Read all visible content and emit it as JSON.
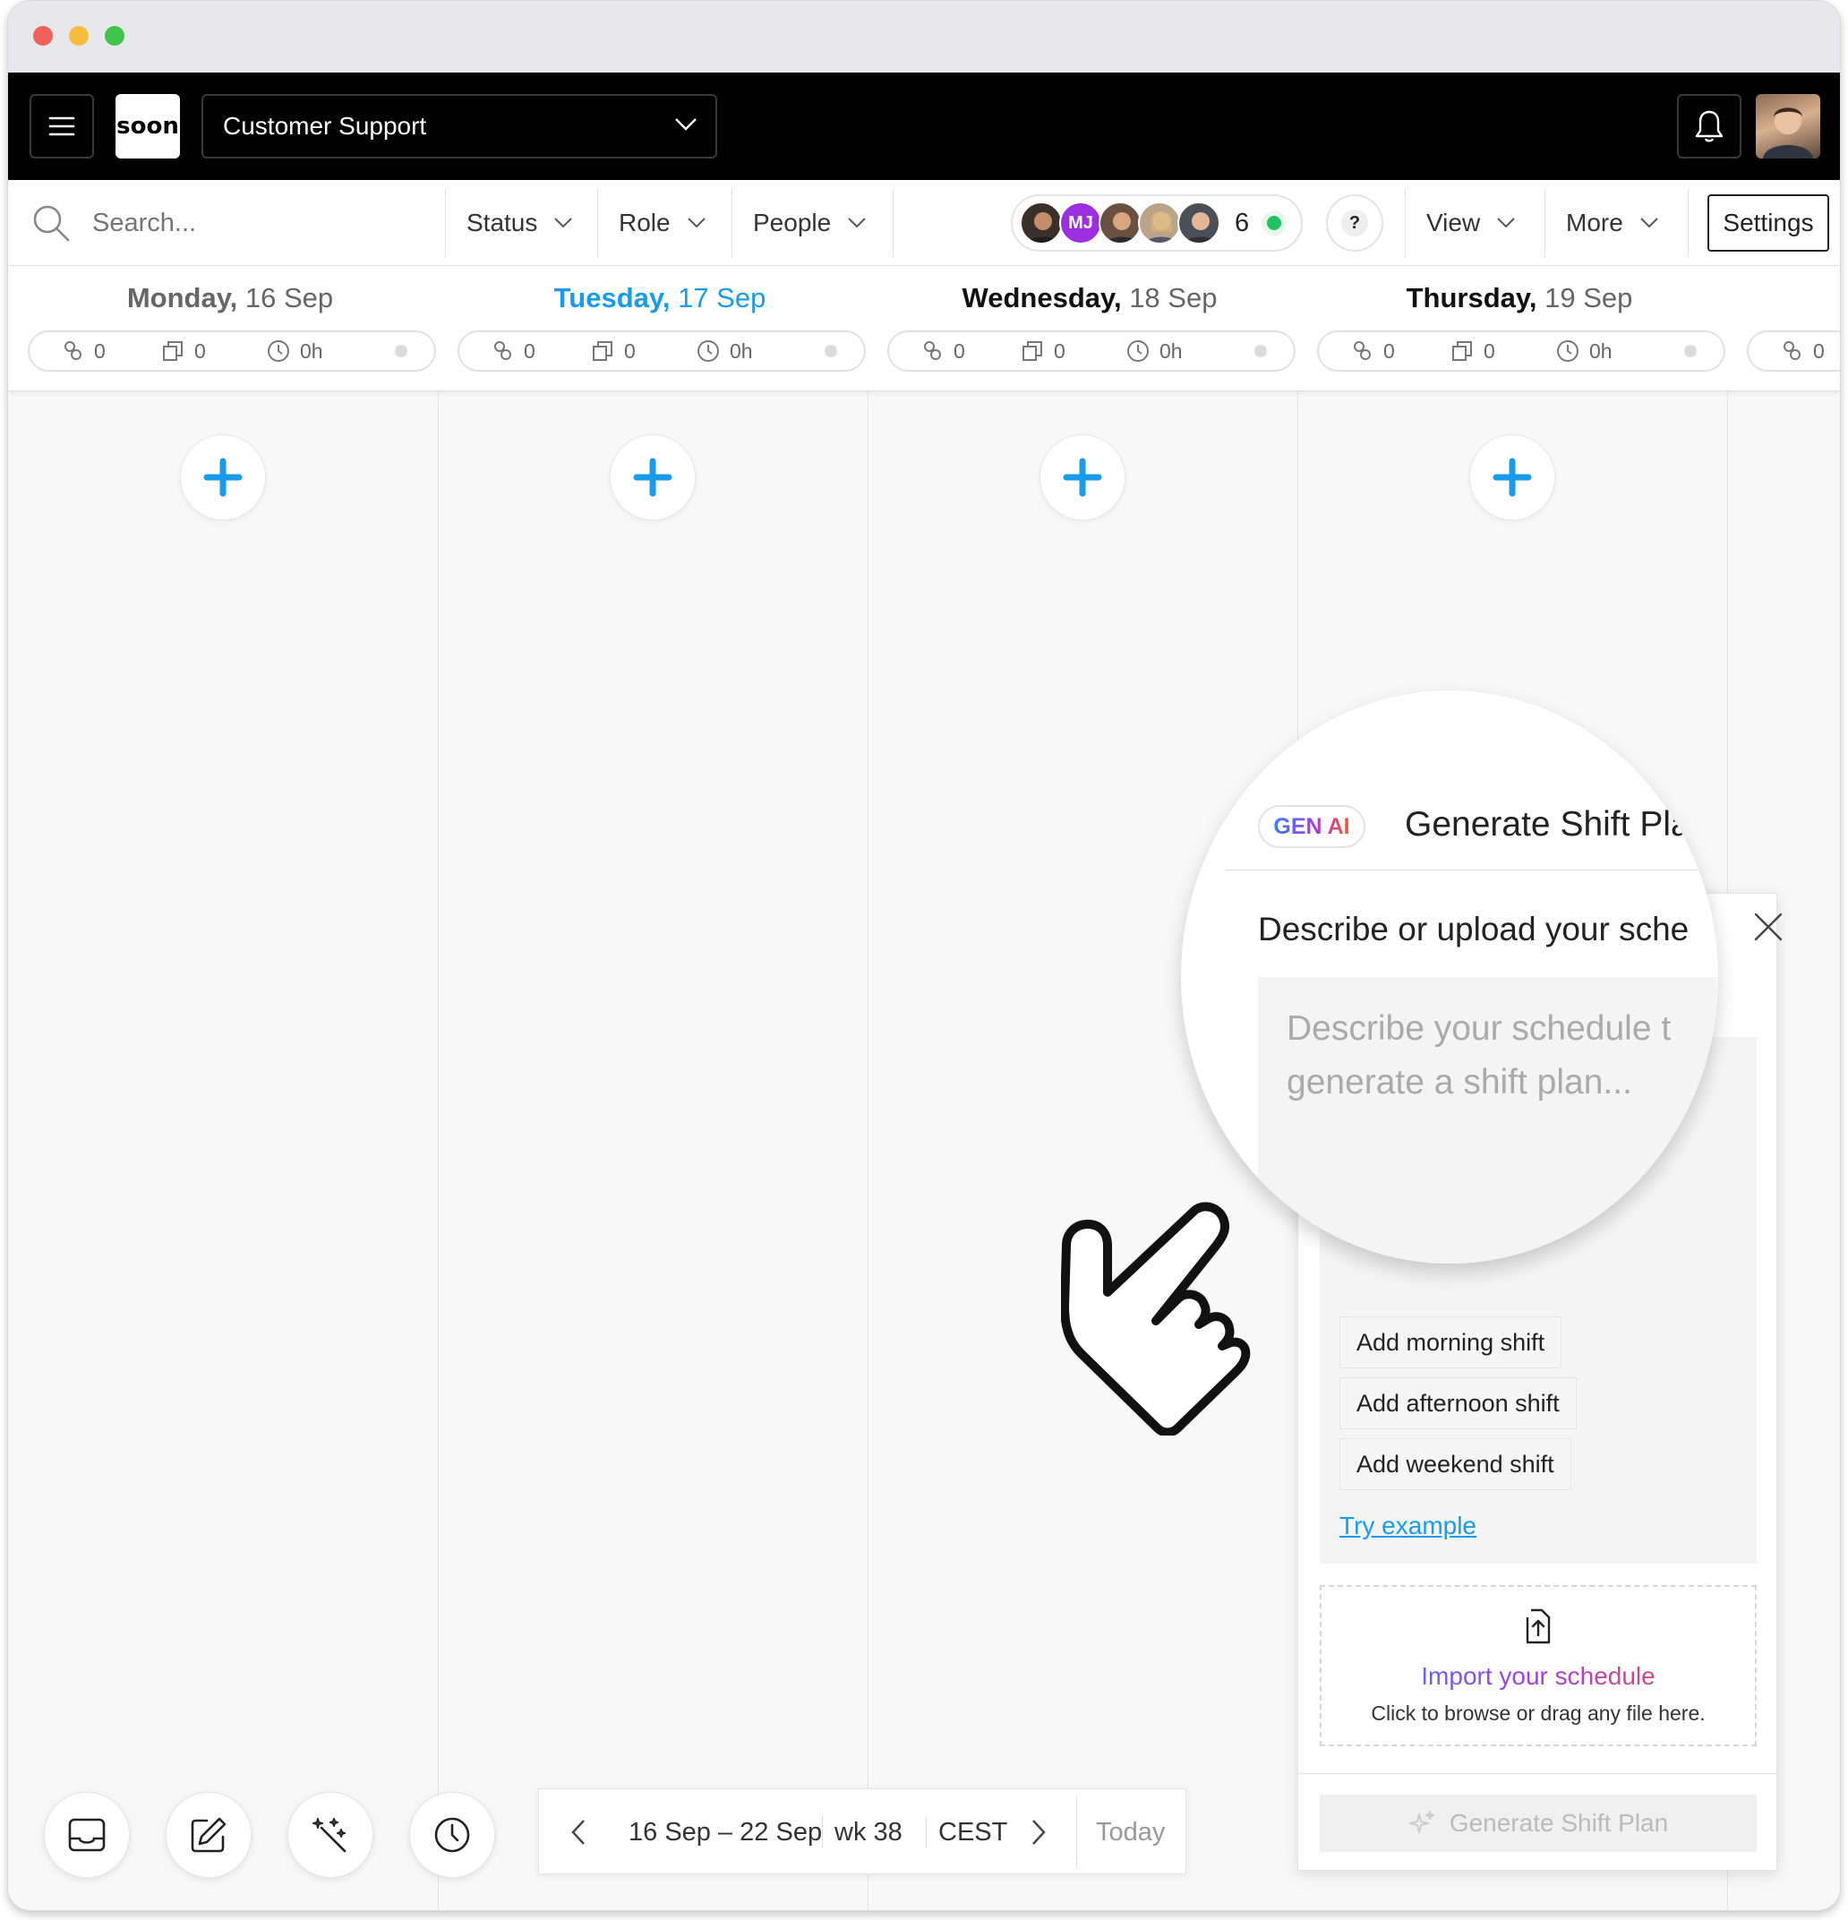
{
  "app": {
    "team": "Customer Support",
    "logo_text": "soon"
  },
  "toolbar": {
    "search_placeholder": "Search...",
    "filters": [
      "Status",
      "Role",
      "People"
    ],
    "avatar_initials": "MJ",
    "online_count": "6",
    "help": "?",
    "view": "View",
    "more": "More",
    "settings": "Settings"
  },
  "days": [
    {
      "weekday": "Monday,",
      "date": "16 Sep",
      "people": "0",
      "shifts": "0",
      "hours": "0h"
    },
    {
      "weekday": "Tuesday,",
      "date": "17 Sep",
      "people": "0",
      "shifts": "0",
      "hours": "0h"
    },
    {
      "weekday": "Wednesday,",
      "date": "18 Sep",
      "people": "0",
      "shifts": "0",
      "hours": "0h"
    },
    {
      "weekday": "Thursday,",
      "date": "19 Sep",
      "people": "0",
      "shifts": "0",
      "hours": "0h"
    },
    {
      "people": "0"
    }
  ],
  "panel": {
    "badge": "GEN AI",
    "title": "Generate Shift Plan",
    "describe_label": "Describe or upload your sche",
    "textarea_placeholder_line1": "Describe your schedule t",
    "textarea_placeholder_line2": "generate a shift plan...",
    "chips": [
      "Add morning shift",
      "Add afternoon shift",
      "Add weekend shift"
    ],
    "try_example": "Try example",
    "import_title": "Import your schedule",
    "import_hint": "Click to browse or drag any file here.",
    "generate_button": "Generate Shift Plan"
  },
  "datebar": {
    "range": "16 Sep – 22 Sep",
    "week": "wk 38",
    "timezone": "CEST",
    "today": "Today"
  },
  "colors": {
    "accent_blue": "#1a9be8",
    "online_green": "#22c35e",
    "mj_avatar": "#9b2fe0"
  }
}
